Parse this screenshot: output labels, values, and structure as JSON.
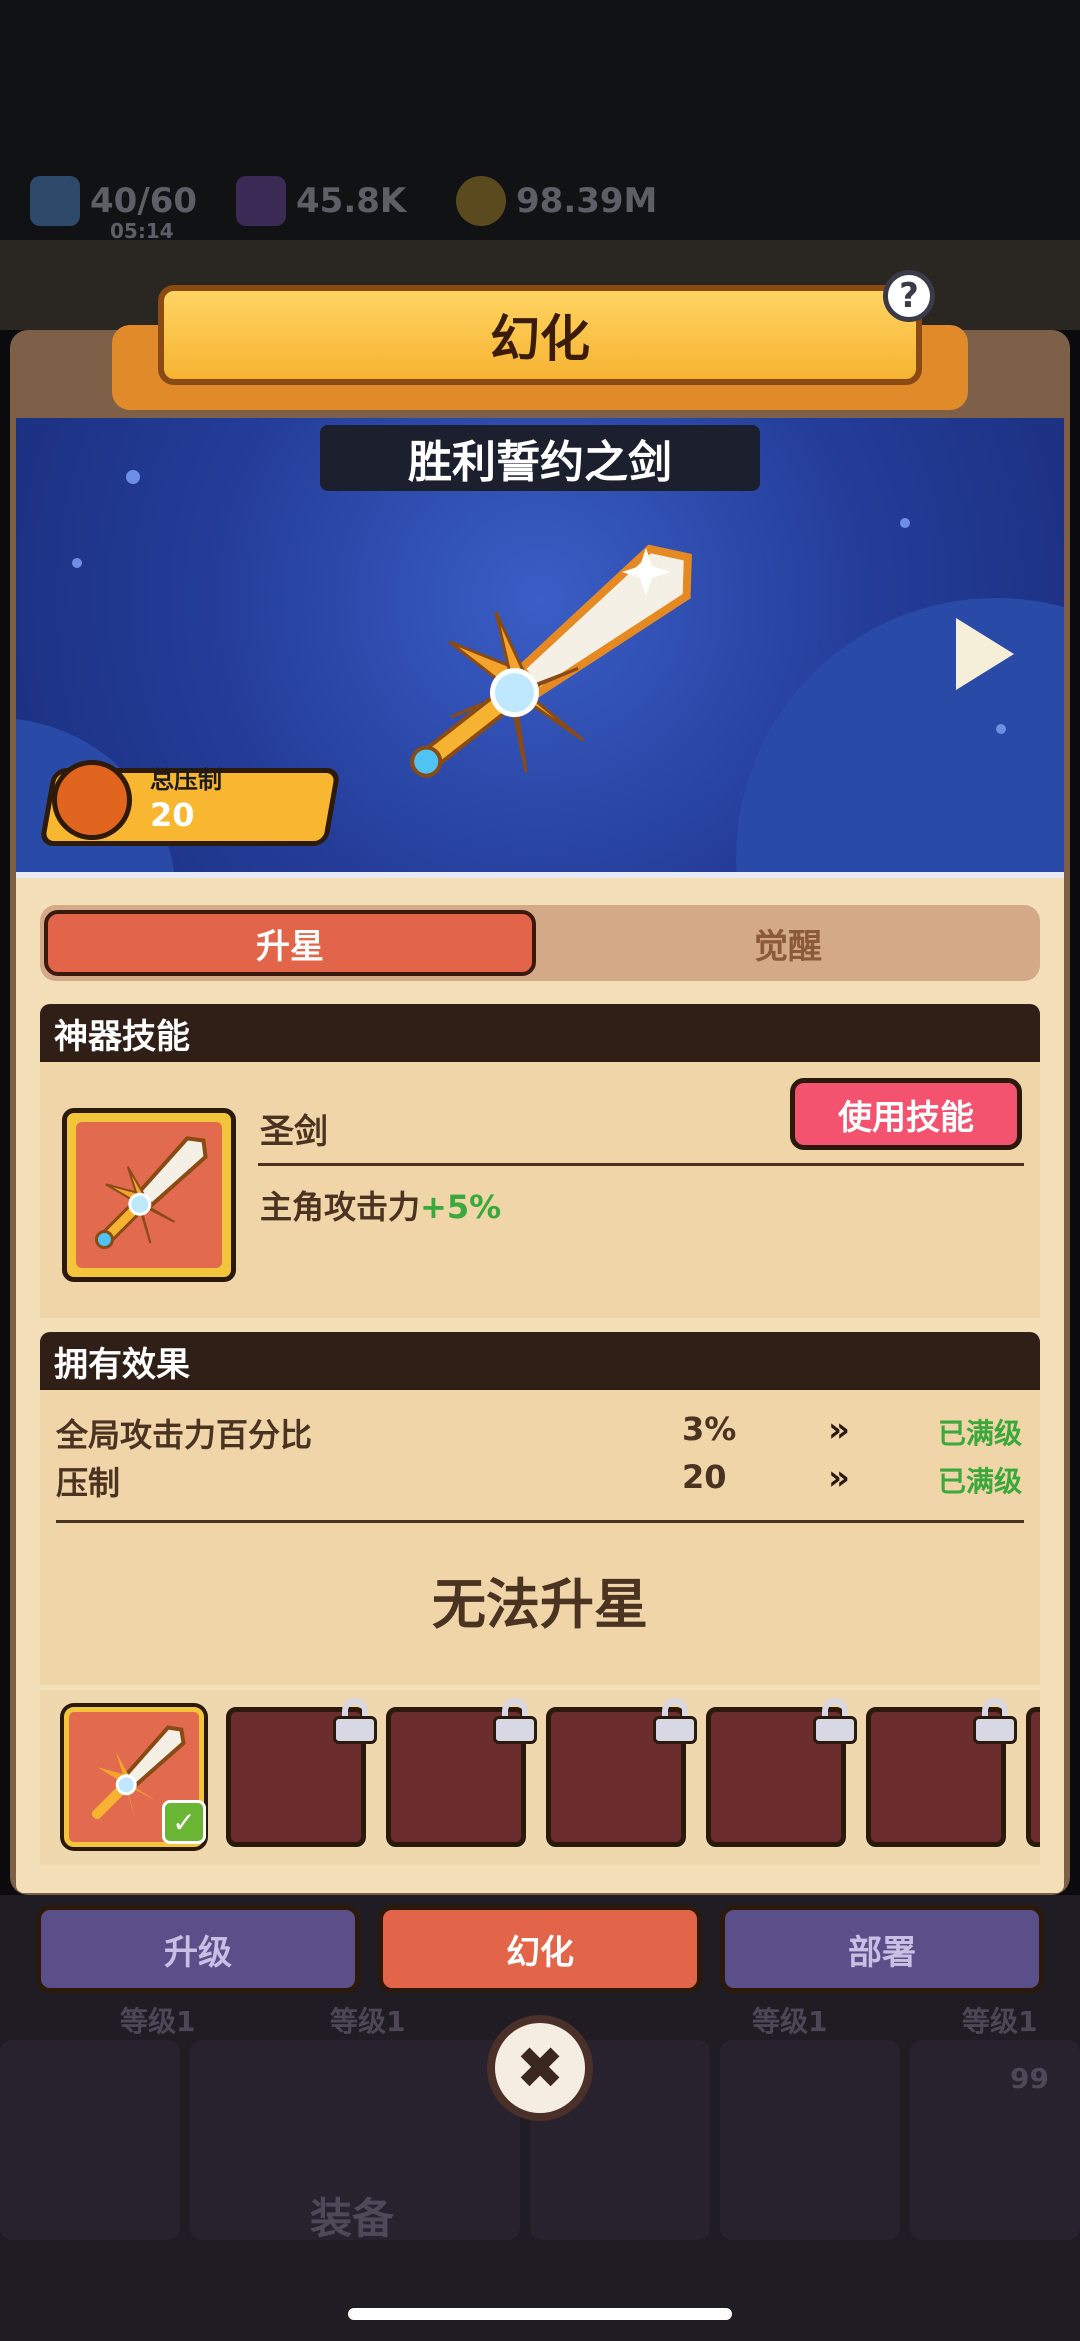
{
  "resources": {
    "energy": "40/60",
    "energy_timer": "05:14",
    "gems": "45.8K",
    "coins": "98.39M"
  },
  "popup": {
    "title": "幻化",
    "help_label": "?",
    "item_name": "胜利誓约之剑",
    "power_label": "总压制",
    "power_value": "20"
  },
  "tabs": [
    {
      "label": "升星",
      "active": true
    },
    {
      "label": "觉醒",
      "active": false
    }
  ],
  "skill": {
    "header": "神器技能",
    "name": "圣剑",
    "use_button": "使用技能",
    "desc_prefix": "主角攻击力",
    "desc_bonus": "+5%"
  },
  "effects": {
    "header": "拥有效果",
    "rows": [
      {
        "label": "全局攻击力百分比",
        "value": "3%",
        "arrow": "»",
        "status": "已满级"
      },
      {
        "label": "压制",
        "value": "20",
        "arrow": "»",
        "status": "已满级"
      }
    ],
    "cannot_upgrade": "无法升星"
  },
  "bottom_tabs": [
    {
      "label": "升级"
    },
    {
      "label": "幻化"
    },
    {
      "label": "部署"
    }
  ],
  "close_label": "✖",
  "background": {
    "level_labels": [
      "等级1",
      "等级1",
      "等级1",
      "等级1"
    ],
    "equip_label": "装备",
    "badge_count": "99"
  },
  "colors": {
    "accent": "#e2654a",
    "green": "#3aa83a",
    "banner": "#f6b331"
  }
}
